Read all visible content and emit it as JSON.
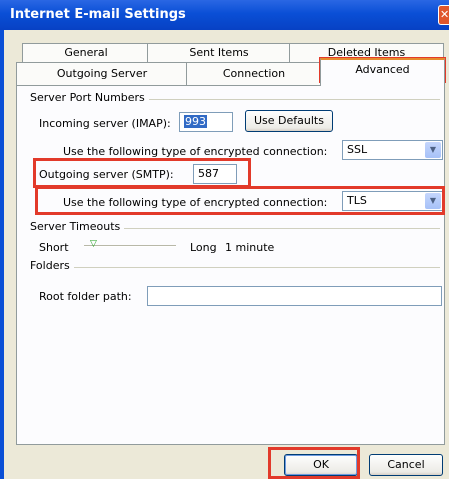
{
  "window": {
    "title": "Internet E-mail Settings"
  },
  "tabs_row1": [
    "General",
    "Sent Items",
    "Deleted Items"
  ],
  "tabs_row2": [
    "Outgoing Server",
    "Connection",
    "Advanced"
  ],
  "server_ports": {
    "group_label": "Server Port Numbers",
    "incoming_label": "Incoming server (IMAP):",
    "incoming_value": "993",
    "use_defaults_label": "Use Defaults",
    "incoming_enc_label": "Use the following type of encrypted connection:",
    "incoming_enc_value": "SSL",
    "outgoing_label": "Outgoing server (SMTP):",
    "outgoing_value": "587",
    "outgoing_enc_label": "Use the following type of encrypted connection:",
    "outgoing_enc_value": "TLS"
  },
  "timeouts": {
    "group_label": "Server Timeouts",
    "short_label": "Short",
    "long_label": "Long",
    "value_label": "1 minute"
  },
  "folders": {
    "group_label": "Folders",
    "root_label": "Root folder path:",
    "root_value": ""
  },
  "buttons": {
    "ok": "OK",
    "cancel": "Cancel"
  },
  "colors": {
    "titlebar": "#0a4fd6",
    "highlight": "#e23a2a",
    "selected_text_bg": "#316ac5"
  }
}
